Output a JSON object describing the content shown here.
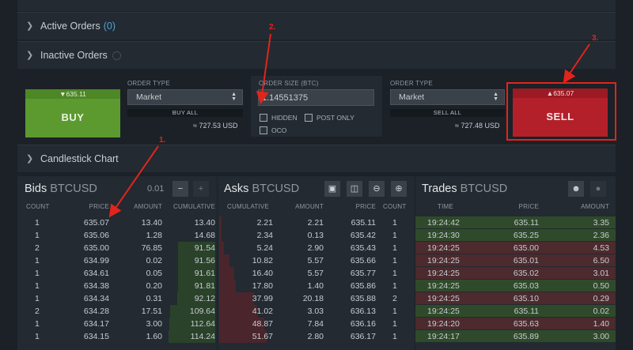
{
  "active_orders": {
    "label": "Active Orders",
    "count": "(0)"
  },
  "inactive_orders": {
    "label": "Inactive Orders"
  },
  "buy_panel": {
    "ticker": "▼635.11",
    "button": "BUY",
    "order_type_label": "ORDER TYPE",
    "order_type_value": "Market",
    "all_label": "BUY ALL",
    "approx": "≈ 727.53 USD"
  },
  "size_panel": {
    "label": "ORDER SIZE (BTC)",
    "value": "1.14551375",
    "hidden": "HIDDEN",
    "post_only": "POST ONLY",
    "oco": "OCO"
  },
  "sell_panel": {
    "ticker": "▲635.07",
    "button": "SELL",
    "order_type_label": "ORDER TYPE",
    "order_type_value": "Market",
    "all_label": "SELL ALL",
    "approx": "≈ 727.48 USD"
  },
  "candlestick": {
    "label": "Candlestick Chart"
  },
  "bids": {
    "title": "Bids",
    "pair": "BTCUSD",
    "precision": "0.01",
    "minus": "−",
    "plus": "+",
    "headers": [
      "COUNT",
      "PRICE",
      "AMOUNT",
      "CUMULATIVE"
    ],
    "rows": [
      [
        "1",
        "635.07",
        "13.40",
        "13.40"
      ],
      [
        "1",
        "635.06",
        "1.28",
        "14.68"
      ],
      [
        "2",
        "635.00",
        "76.85",
        "91.54"
      ],
      [
        "1",
        "634.99",
        "0.02",
        "91.56"
      ],
      [
        "1",
        "634.61",
        "0.05",
        "91.61"
      ],
      [
        "1",
        "634.38",
        "0.20",
        "91.81"
      ],
      [
        "1",
        "634.34",
        "0.31",
        "92.12"
      ],
      [
        "2",
        "634.28",
        "17.51",
        "109.64"
      ],
      [
        "1",
        "634.17",
        "3.00",
        "112.64"
      ],
      [
        "1",
        "634.15",
        "1.60",
        "114.24"
      ]
    ]
  },
  "asks": {
    "title": "Asks",
    "pair": "BTCUSD",
    "headers": [
      "CUMULATIVE",
      "AMOUNT",
      "PRICE",
      "COUNT"
    ],
    "rows": [
      [
        "2.21",
        "2.21",
        "635.11",
        "1"
      ],
      [
        "2.34",
        "0.13",
        "635.42",
        "1"
      ],
      [
        "5.24",
        "2.90",
        "635.43",
        "1"
      ],
      [
        "10.82",
        "5.57",
        "635.66",
        "1"
      ],
      [
        "16.40",
        "5.57",
        "635.77",
        "1"
      ],
      [
        "17.80",
        "1.40",
        "635.86",
        "1"
      ],
      [
        "37.99",
        "20.18",
        "635.88",
        "2"
      ],
      [
        "41.02",
        "3.03",
        "636.13",
        "1"
      ],
      [
        "48.87",
        "7.84",
        "636.16",
        "1"
      ],
      [
        "51.67",
        "2.80",
        "636.17",
        "1"
      ]
    ]
  },
  "trades": {
    "title": "Trades",
    "pair": "BTCUSD",
    "headers": [
      "TIME",
      "PRICE",
      "AMOUNT"
    ],
    "rows": [
      [
        "19:24:42",
        "635.11",
        "3.35",
        "buy"
      ],
      [
        "19:24:30",
        "635.25",
        "2.36",
        "buy"
      ],
      [
        "19:24:25",
        "635.00",
        "4.53",
        "sell"
      ],
      [
        "19:24:25",
        "635.01",
        "6.50",
        "sell"
      ],
      [
        "19:24:25",
        "635.02",
        "3.01",
        "sell"
      ],
      [
        "19:24:25",
        "635.03",
        "0.50",
        "buy"
      ],
      [
        "19:24:25",
        "635.10",
        "0.29",
        "sell"
      ],
      [
        "19:24:25",
        "635.11",
        "0.02",
        "buy"
      ],
      [
        "19:24:20",
        "635.63",
        "1.40",
        "sell"
      ],
      [
        "19:24:17",
        "635.89",
        "3.00",
        "buy"
      ]
    ]
  },
  "annotations": {
    "a1": "1.",
    "a2": "2.",
    "a3": "3."
  },
  "colors": {
    "buy": "#5c9a2f",
    "sell": "#b3202a",
    "annotation": "#e0251c",
    "accent": "#4fa3d9"
  }
}
